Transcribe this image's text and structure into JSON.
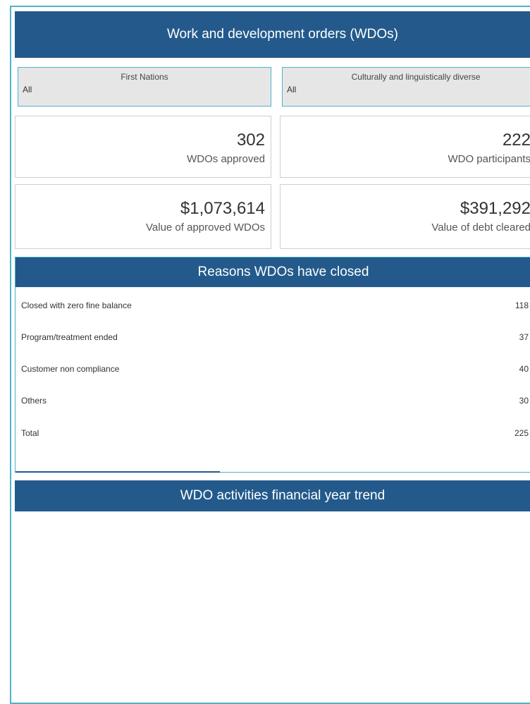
{
  "header": {
    "title": "Work and development orders (WDOs)"
  },
  "filters": {
    "first_nations": {
      "title": "First Nations",
      "value": "All"
    },
    "cald": {
      "title": "Culturally and linguistically diverse",
      "value": "All"
    }
  },
  "kpis": {
    "wdos_approved": {
      "value": "302",
      "label": "WDOs approved"
    },
    "wdo_participants": {
      "value": "222",
      "label": "WDO participants"
    },
    "value_approved": {
      "value": "$1,073,614",
      "label": "Value of approved WDOs"
    },
    "debt_cleared": {
      "value": "$391,292",
      "label": "Value of debt cleared"
    }
  },
  "reasons": {
    "title": "Reasons WDOs have closed",
    "rows": [
      {
        "label": "Closed with zero fine balance",
        "value": "118"
      },
      {
        "label": "Program/treatment ended",
        "value": "37"
      },
      {
        "label": "Customer non compliance",
        "value": "40"
      },
      {
        "label": "Others",
        "value": "30"
      },
      {
        "label": "Total",
        "value": "225"
      }
    ]
  },
  "trend": {
    "title": "WDO activities financial year trend"
  }
}
